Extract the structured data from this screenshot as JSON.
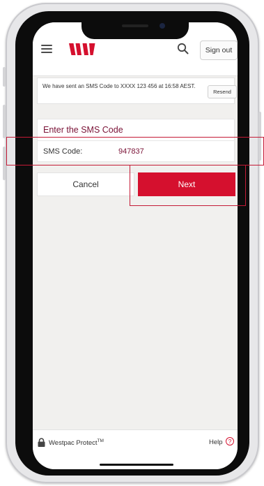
{
  "header": {
    "menu_icon": "hamburger-menu-icon",
    "logo_icon": "westpac-logo-icon",
    "search_icon": "search-icon",
    "sign_out_label": "Sign out"
  },
  "notice": {
    "message": "We have sent an SMS Code to XXXX 123 456 at 16:58 AEST.",
    "resend_label": "Resend"
  },
  "sms": {
    "title": "Enter the SMS Code",
    "label": "SMS Code:",
    "value": "947837"
  },
  "actions": {
    "cancel_label": "Cancel",
    "next_label": "Next"
  },
  "footer": {
    "protect_label": "Westpac Protect",
    "protect_sup": "TM",
    "help_label": "Help",
    "help_icon_glyph": "?"
  },
  "colors": {
    "brand_red": "#d5102e",
    "accent_maroon": "#7a1236",
    "highlight": "#c41a36"
  }
}
